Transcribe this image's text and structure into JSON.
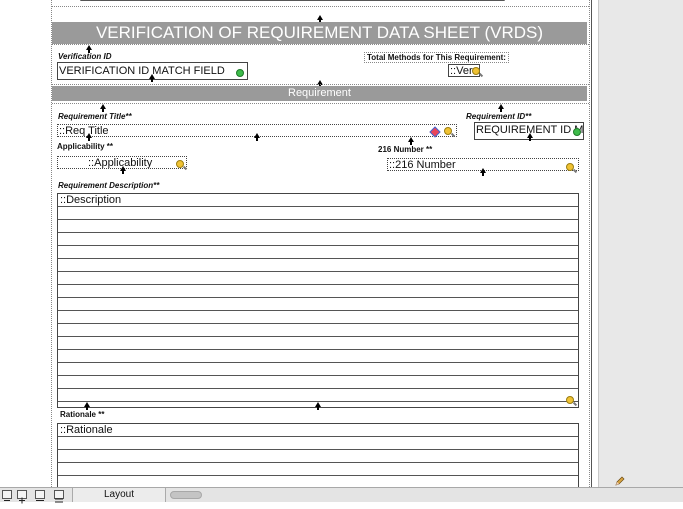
{
  "sheet": {
    "title": "VERIFICATION OF REQUIREMENT DATA SHEET (VRDS)",
    "requirement_banner": "Requirement"
  },
  "fields": {
    "verification_id": {
      "label": "Verification ID",
      "value": "VERIFICATION ID MATCH FIELD"
    },
    "total_methods": {
      "label": "Total Methods for This Requirement:",
      "value": "::Ver"
    },
    "requirement_title": {
      "label": "Requirement Title**",
      "value": "::Req Title"
    },
    "requirement_id": {
      "label": "Requirement ID**",
      "value": "REQUIREMENT ID MATCH FIELD"
    },
    "applicability": {
      "label": "Applicability **",
      "value": "::Applicability"
    },
    "number_216": {
      "label": "216 Number **",
      "value": "::216 Number"
    },
    "requirement_description": {
      "label": "Requirement Description**",
      "value": "::Description"
    },
    "rationale": {
      "label": "Rationale **",
      "value": "::Rationale"
    }
  },
  "statusbar": {
    "tab_label": "Layout"
  },
  "icons": [
    "magnifier-icon",
    "green-status-icon",
    "diamond-icon",
    "up-arrow-icon",
    "pencil-icon"
  ]
}
